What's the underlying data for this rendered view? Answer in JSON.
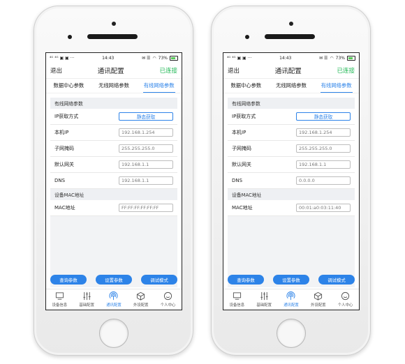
{
  "statusbar": {
    "signal": "⁴ᴳ ⁴ᴳ ▣ ▣ ···",
    "time": "14:43",
    "extra": "✉ ☰",
    "battery": "73%"
  },
  "nav": {
    "back": "退出",
    "title": "通讯配置",
    "status": "已连接"
  },
  "tabs": [
    {
      "label": "数据中心参数"
    },
    {
      "label": "无线网络参数"
    },
    {
      "label": "有线网络参数"
    }
  ],
  "sections": {
    "wired": "有线网络参数",
    "mac": "设备MAC地址"
  },
  "labels": {
    "ip_mode": "IP获取方式",
    "ip": "本机IP",
    "mask": "子网掩码",
    "gateway": "默认网关",
    "dns": "DNS",
    "mac": "MAC地址"
  },
  "buttons": {
    "query": "查询参数",
    "set": "设置参数",
    "debug": "调试模式"
  },
  "bottom_nav": [
    {
      "label": "设备信息",
      "icon": "monitor-icon"
    },
    {
      "label": "基础配置",
      "icon": "sliders-icon"
    },
    {
      "label": "通讯配置",
      "icon": "signal-icon"
    },
    {
      "label": "外设配置",
      "icon": "cube-icon"
    },
    {
      "label": "个人中心",
      "icon": "smile-icon"
    }
  ],
  "phones": [
    {
      "ip_mode": "静态获取",
      "ip": "192.168.1.254",
      "mask": "255.255.255.0",
      "gateway": "192.168.1.1",
      "dns": "192.168.1.1",
      "mac": "FF:FF:FF:FF:FF:FF"
    },
    {
      "ip_mode": "静态获取",
      "ip": "192.168.1.254",
      "mask": "255.255.255.0",
      "gateway": "192.168.1.1",
      "dns": "0.0.0.0",
      "mac": "00:01:a0:03:11:40"
    }
  ],
  "colors": {
    "accent": "#2d83e8",
    "connected": "#21b856"
  }
}
